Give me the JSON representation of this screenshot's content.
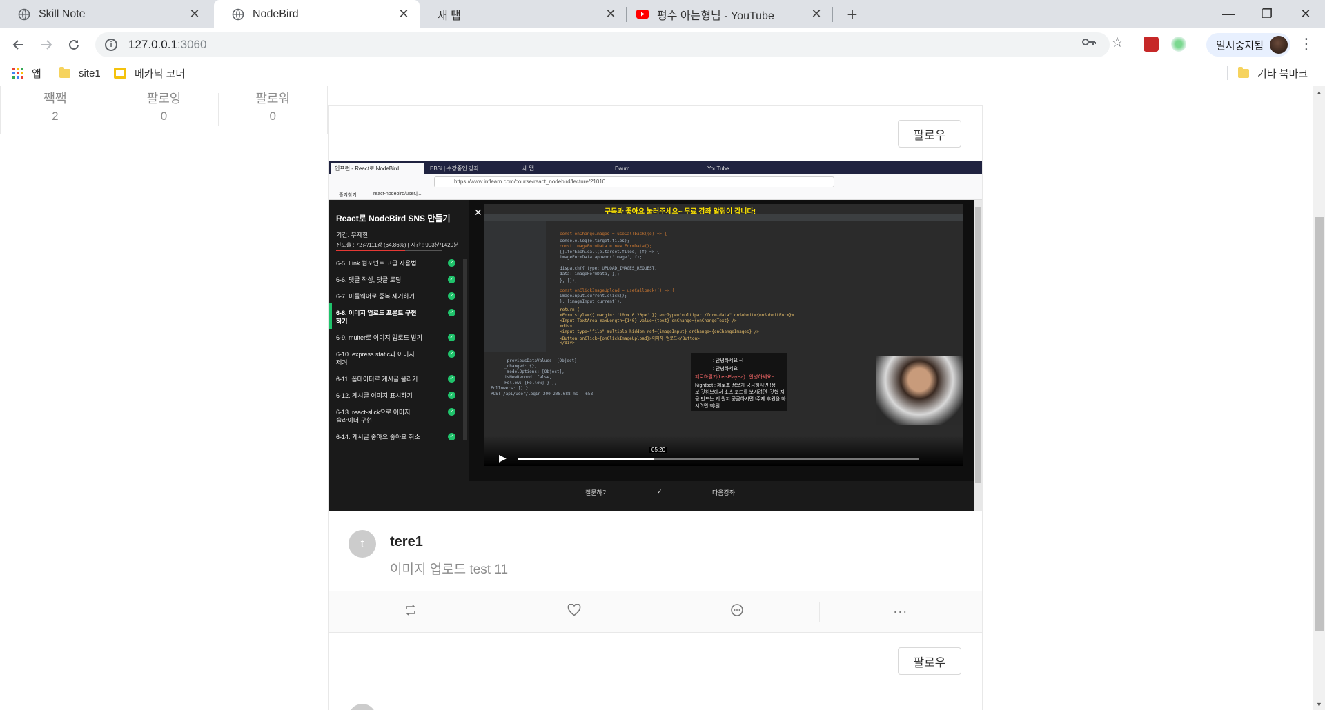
{
  "browser": {
    "tabs": [
      {
        "title": "Skill Note",
        "active": false,
        "favicon": "globe-icon"
      },
      {
        "title": "NodeBird",
        "active": true,
        "favicon": "globe-icon"
      },
      {
        "title": "새 탭",
        "active": false,
        "favicon": "none"
      },
      {
        "title": "평수 아는형님 - YouTube",
        "active": false,
        "favicon": "youtube-icon"
      }
    ],
    "url_host": "127.0.0.1",
    "url_port": ":3060",
    "profile_status": "일시중지됨",
    "bookmarks": [
      {
        "label": "앱",
        "icon": "apps-grid-icon"
      },
      {
        "label": "site1",
        "icon": "folder-icon"
      },
      {
        "label": "메카닉 코더",
        "icon": "mechanic-coder-icon"
      }
    ],
    "other_bookmarks": "기타 북마크"
  },
  "profile_stats": [
    {
      "label": "짹짹",
      "value": "2"
    },
    {
      "label": "팔로잉",
      "value": "0"
    },
    {
      "label": "팔로워",
      "value": "0"
    }
  ],
  "post": {
    "follow_label": "팔로우",
    "avatar_initial": "t",
    "username": "tere1",
    "content": "이미지 업로드 test 11",
    "actions": [
      "retweet-icon",
      "heart-icon",
      "comment-icon",
      "ellipsis-icon"
    ]
  },
  "post2": {
    "follow_label": "팔로우"
  },
  "embedded_screenshot": {
    "tabs": [
      "인프런 - React로 NodeBird",
      "EBSi | 수강중인 강좌",
      "새 탭",
      "Daum",
      "YouTube"
    ],
    "url": "https://www.inflearn.com/course/react_nodebird/lecture/21010",
    "bookmarks": [
      "즐겨찾기",
      "react-nodebird/user.j..."
    ],
    "course_title": "React로 NodeBird SNS 만들기",
    "period": "기간: 무제한",
    "progress_text": "진도율 : 72강/111강 (64.86%) | 시간 : 903분/1420분",
    "progress_fraction": 0.6486,
    "lessons": [
      "6-5. Link 컴포넌트 고급 사용법",
      "6-6. 댓글 작성, 댓글 로딩",
      "6-7. 미들웨어로 중복 제거하기",
      "6-8. 이미지 업로드 프론트 구현하기",
      "6-9. multer로 이미지 업로드 받기",
      "6-10. express.static과 이미지 제거",
      "6-11. 폼데이터로 게시글 올리기",
      "6-12. 게시글 이미지 표시하기",
      "6-13. react-slick으로 이미지 슬라이더 구현",
      "6-14. 게시글 좋아요 좋아요 취소"
    ],
    "banner": "구독과 좋아요 눌러주세요~ 무료 강좌 알림이 갑니다!",
    "video_time": "05:20",
    "chat": [
      ": 안녕하세요 ~!",
      ": 안녕하세요",
      "제로하필기(LetsPlayHa) : 안녕하세요~",
      "Nightbot : 제로초 정보가 궁금하시면 !정",
      "보 깃허브에서 소스 코드를 보시려면 !깃헙 지",
      "금 만드는 게 뭔지 궁금하시면 !주제 후원을 하",
      "시려면 !후원"
    ],
    "bottom_actions": [
      "질문하기",
      "✓",
      "다음강좌"
    ]
  }
}
